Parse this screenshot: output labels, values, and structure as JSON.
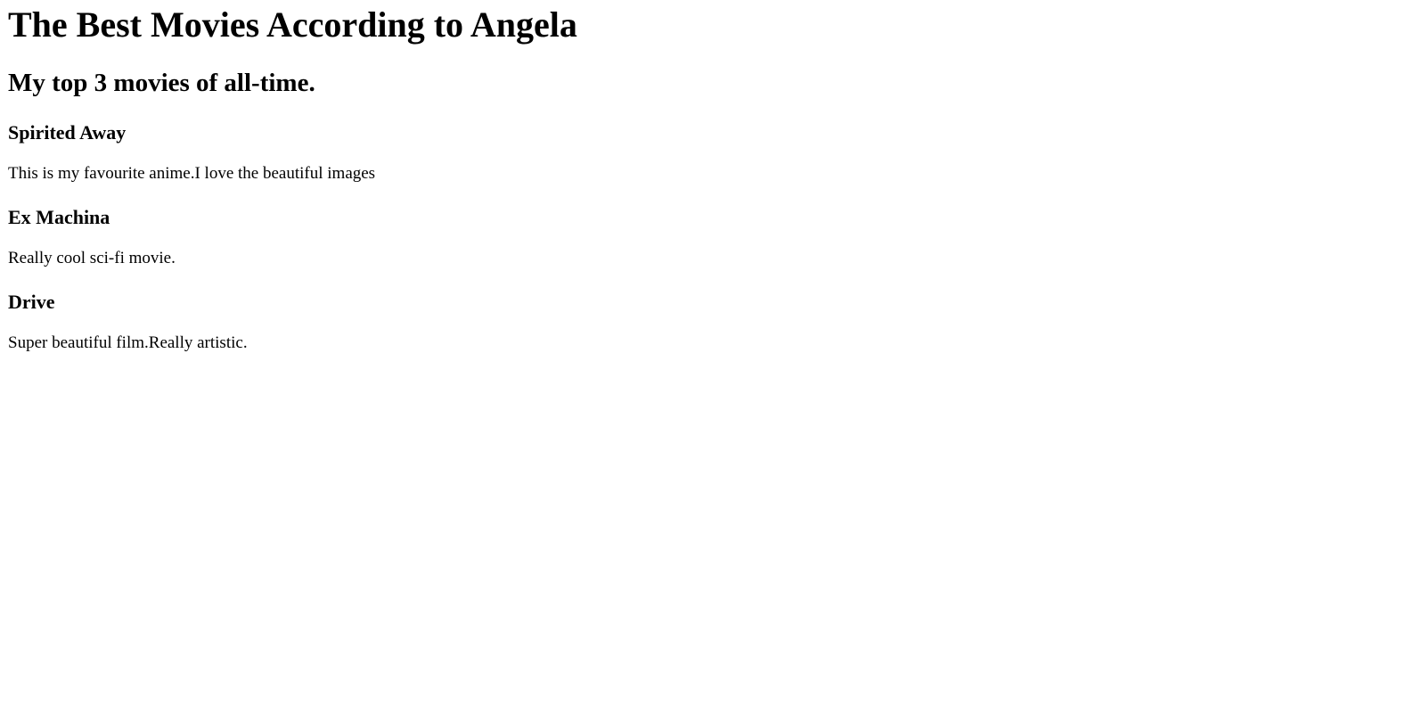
{
  "page": {
    "title": "The Best Movies According to Angela",
    "subtitle": "My top 3 movies of all-time."
  },
  "movies": [
    {
      "title": "Spirited Away",
      "description": "This is my favourite anime.I love the beautiful images"
    },
    {
      "title": "Ex Machina",
      "description": "Really cool sci-fi movie."
    },
    {
      "title": "Drive",
      "description": "Super beautiful film.Really artistic."
    }
  ],
  "colors": {
    "background": "#ffffff",
    "text": "#000000"
  }
}
